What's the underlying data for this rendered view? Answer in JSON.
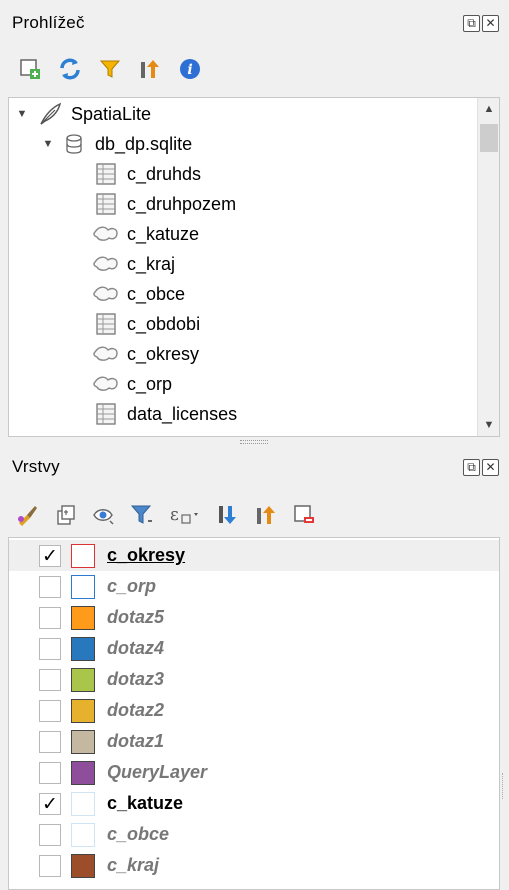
{
  "browser_panel": {
    "title": "Prohlížeč",
    "float_icon": "⧉",
    "close_icon": "✕",
    "toolbar": [
      "add-layer-icon",
      "refresh-icon",
      "filter-icon",
      "collapse-all-icon",
      "properties-info-icon"
    ],
    "tree": [
      {
        "label": "SpatiaLite",
        "icon": "feather-icon",
        "expanded": true,
        "level": 0
      },
      {
        "label": "db_dp.sqlite",
        "icon": "database-icon",
        "expanded": true,
        "level": 1
      },
      {
        "label": "c_druhds",
        "icon": "table-icon",
        "level": 2
      },
      {
        "label": "c_druhpozem",
        "icon": "table-icon",
        "level": 2
      },
      {
        "label": "c_katuze",
        "icon": "polygon-icon",
        "level": 2
      },
      {
        "label": "c_kraj",
        "icon": "polygon-icon",
        "level": 2
      },
      {
        "label": "c_obce",
        "icon": "polygon-icon",
        "level": 2
      },
      {
        "label": "c_obdobi",
        "icon": "table-icon",
        "level": 2
      },
      {
        "label": "c_okresy",
        "icon": "polygon-icon",
        "level": 2
      },
      {
        "label": "c_orp",
        "icon": "polygon-icon",
        "level": 2
      },
      {
        "label": "data_licenses",
        "icon": "table-icon",
        "level": 2
      }
    ]
  },
  "layers_panel": {
    "title": "Vrstvy",
    "toolbar": [
      "style-brush-icon",
      "add-group-icon",
      "visibility-eye-icon",
      "filter-legend-icon",
      "expression-filter-icon",
      "expand-all-icon",
      "collapse-all-icon",
      "remove-layer-icon"
    ],
    "layers": [
      {
        "name": "c_okresy",
        "checked": "✓",
        "color": "#ffffff",
        "border": "#e03131",
        "style": "bold",
        "underline": true,
        "selected": true
      },
      {
        "name": "c_orp",
        "checked": "",
        "color": "#ffffff",
        "border": "#2b7bd0",
        "style": "italic"
      },
      {
        "name": "dotaz5",
        "checked": "",
        "color": "#ff9a1a",
        "border": "#555555",
        "style": "italic"
      },
      {
        "name": "dotaz4",
        "checked": "",
        "color": "#2878bd",
        "border": "#555555",
        "style": "italic"
      },
      {
        "name": "dotaz3",
        "checked": "",
        "color": "#a9c54a",
        "border": "#555555",
        "style": "italic"
      },
      {
        "name": "dotaz2",
        "checked": "",
        "color": "#e6b22e",
        "border": "#555555",
        "style": "italic"
      },
      {
        "name": "dotaz1",
        "checked": "",
        "color": "#c4b9a0",
        "border": "#555555",
        "style": "italic"
      },
      {
        "name": "QueryLayer",
        "checked": "",
        "color": "#8e4e9c",
        "border": "#555555",
        "style": "italic"
      },
      {
        "name": "c_katuze",
        "checked": "✓",
        "color": "#ffffff",
        "border": "#cfe4f4",
        "style": "bold"
      },
      {
        "name": "c_obce",
        "checked": "",
        "color": "#ffffff",
        "border": "#cfe4f4",
        "style": "italic"
      },
      {
        "name": "c_kraj",
        "checked": "",
        "color": "#9c4e2a",
        "border": "#555555",
        "style": "italic"
      }
    ]
  }
}
